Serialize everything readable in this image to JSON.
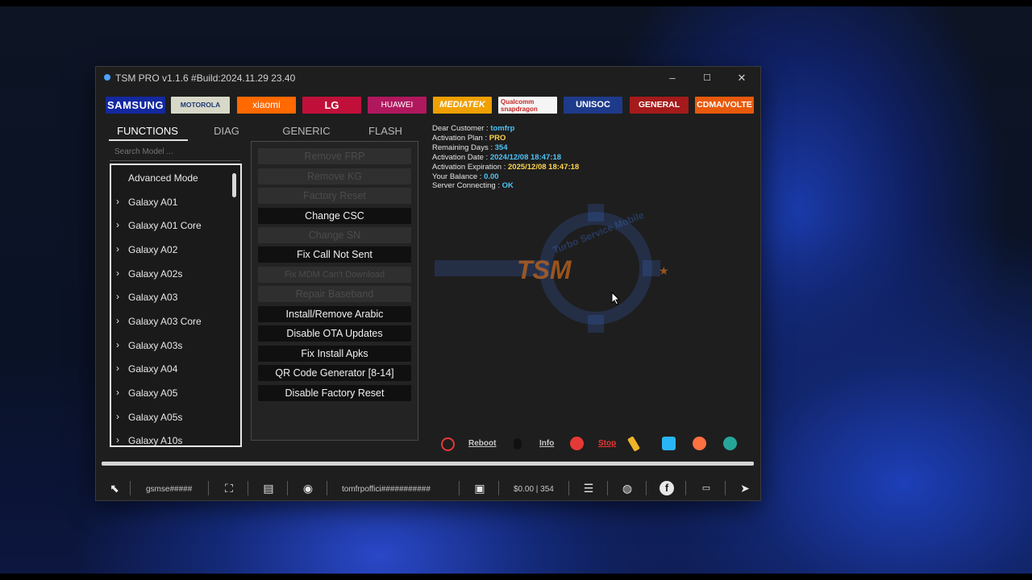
{
  "window": {
    "title": "TSM PRO v1.1.6 #Build:2024.11.29 23.40",
    "minimize": "–",
    "maximize": "☐",
    "close": "✕"
  },
  "brands": [
    {
      "label": "SAMSUNG",
      "color": "#1428a0"
    },
    {
      "label": "MOTOROLA",
      "color": "#6b8f2a"
    },
    {
      "label": "xiaomi",
      "color": "#ff6900"
    },
    {
      "label": "LG",
      "color": "#c0103a"
    },
    {
      "label": "HUAWEI",
      "color": "#c2185b"
    },
    {
      "label": "MEDIATEK",
      "color": "#f0a000"
    },
    {
      "label": "Qualcomm snapdragon",
      "color": "#f2f2f2"
    },
    {
      "label": "UNISOC",
      "color": "#1e3a8a"
    },
    {
      "label": "GENERAL",
      "color": "#b71c1c"
    },
    {
      "label": "CDMA/VOLTE",
      "color": "#e8590c"
    }
  ],
  "tabs": [
    "FUNCTIONS",
    "DIAG",
    "GENERIC",
    "FLASH"
  ],
  "search": {
    "placeholder": "Search Model ..."
  },
  "models": [
    "Advanced Mode",
    "Galaxy A01",
    "Galaxy A01 Core",
    "Galaxy A02",
    "Galaxy A02s",
    "Galaxy A03",
    "Galaxy A03 Core",
    "Galaxy A03s",
    "Galaxy A04",
    "Galaxy A05",
    "Galaxy A05s",
    "Galaxy A10s"
  ],
  "functions": [
    {
      "label": "Remove FRP",
      "enabled": false
    },
    {
      "label": "Remove KG",
      "enabled": false
    },
    {
      "label": "Factory Reset",
      "enabled": false
    },
    {
      "label": "Change CSC",
      "enabled": true
    },
    {
      "label": "Change SN",
      "enabled": false
    },
    {
      "label": "Fix Call Not Sent",
      "enabled": true
    },
    {
      "label": "Fix MDM Can't Download",
      "enabled": false
    },
    {
      "label": "Repair Baseband",
      "enabled": false
    },
    {
      "label": "Install/Remove Arabic",
      "enabled": true
    },
    {
      "label": "Disable OTA Updates",
      "enabled": true
    },
    {
      "label": "Fix Install Apks",
      "enabled": true
    },
    {
      "label": "QR Code Generator [8-14]",
      "enabled": true
    },
    {
      "label": "Disable Factory Reset",
      "enabled": true
    }
  ],
  "account": [
    {
      "label": "Dear Customer : ",
      "value": "tomfrp",
      "color": "#4fc3f7"
    },
    {
      "label": "Activation Plan : ",
      "value": "PRO",
      "color": "#ffd54f"
    },
    {
      "label": "Remaining Days : ",
      "value": "354",
      "color": "#4fc3f7"
    },
    {
      "label": "Activation Date : ",
      "value": "2024/12/08 18:47:18",
      "color": "#4fc3f7"
    },
    {
      "label": "Activation Expiration : ",
      "value": "2025/12/08 18:47:18",
      "color": "#ffd54f"
    },
    {
      "label": "Your Balance : ",
      "value": "0.00",
      "color": "#4fc3f7"
    },
    {
      "label": "Server Connecting : ",
      "value": "OK",
      "color": "#4fc3f7"
    }
  ],
  "watermark": {
    "brand": "TSM",
    "ring_text": "Turbo Service Mobile"
  },
  "actions": {
    "reboot": "Reboot",
    "info": "Info",
    "stop": "Stop"
  },
  "progress": {
    "fraction": 1.0
  },
  "statusbar": {
    "user_masked": "gsmse#####",
    "account_masked": "tomfrpoffici###########",
    "balance_days": "$0.00 | 354"
  }
}
